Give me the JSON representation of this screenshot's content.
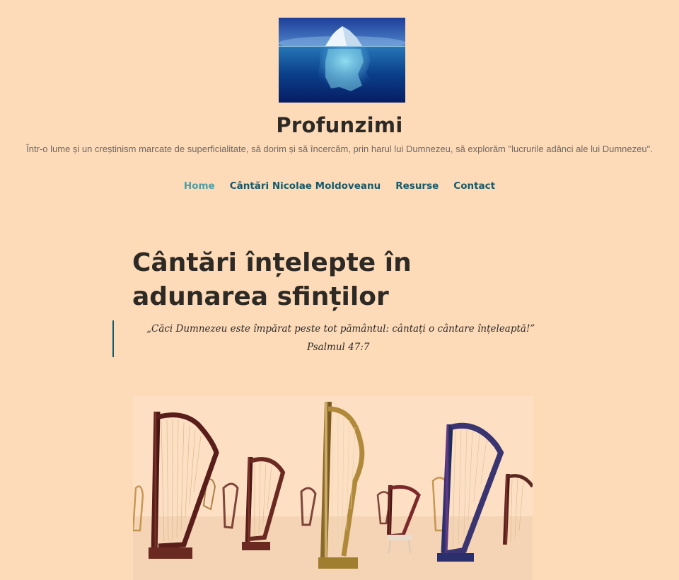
{
  "site": {
    "title": "Profunzimi",
    "tagline": "Într-o lume și un creștinism marcate de superficialitate, să dorim și să încercăm, prin harul lui Dumnezeu, să explorăm \"lucrurile adânci ale lui Dumnezeu\"."
  },
  "nav": {
    "items": [
      {
        "label": "Home",
        "current": true
      },
      {
        "label": "Cântări Nicolae Moldoveanu",
        "current": false
      },
      {
        "label": "Resurse",
        "current": false
      },
      {
        "label": "Contact",
        "current": false
      }
    ]
  },
  "post": {
    "title_line1": "Cântări înțelepte în",
    "title_line2": "adunarea sfinților",
    "quote_text": "„Căci Dumnezeu este împărat peste tot pământul: cântați o cântare înțeleaptă!”",
    "quote_ref": "Psalmul 47:7"
  },
  "colors": {
    "background": "#fedbb8",
    "link": "#145a6b",
    "link_current": "#4a9ea8"
  },
  "images": {
    "logo": "iceberg-logo",
    "featured": "harps-image"
  }
}
